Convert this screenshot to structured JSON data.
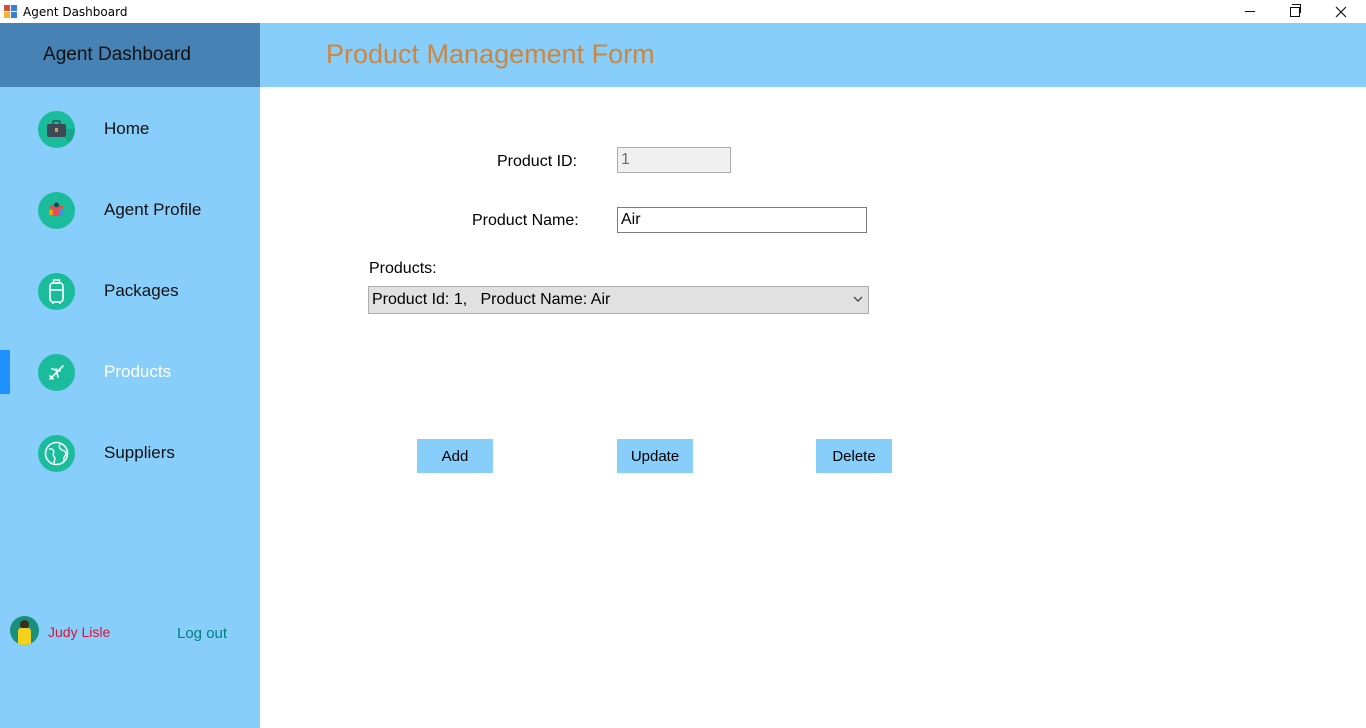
{
  "window": {
    "title": "Agent Dashboard"
  },
  "sidebar": {
    "header": "Agent Dashboard",
    "items": [
      {
        "label": "Home",
        "icon": "briefcase-icon"
      },
      {
        "label": "Agent Profile",
        "icon": "profile-icon"
      },
      {
        "label": "Packages",
        "icon": "luggage-icon"
      },
      {
        "label": "Products",
        "icon": "airplane-icon",
        "active": true
      },
      {
        "label": "Suppliers",
        "icon": "globe-icon"
      }
    ],
    "user": {
      "name": "Judy Lisle"
    },
    "logout_label": "Log out"
  },
  "main": {
    "title": "Product Management Form",
    "form": {
      "product_id_label": "Product ID:",
      "product_id_value": "1",
      "product_name_label": "Product Name:",
      "product_name_value": "Air",
      "products_label": "Products:",
      "products_selected": "Product Id: 1,   Product Name: Air"
    },
    "buttons": {
      "add": "Add",
      "update": "Update",
      "delete": "Delete"
    }
  },
  "colors": {
    "sidebar_bg": "#87cefa",
    "sidebar_header_bg": "#4682b4",
    "title_color": "#cd853f",
    "icon_bg": "#1abc9c",
    "active_indicator": "#1e90ff",
    "user_name": "#dc143c",
    "logout": "#008080"
  }
}
